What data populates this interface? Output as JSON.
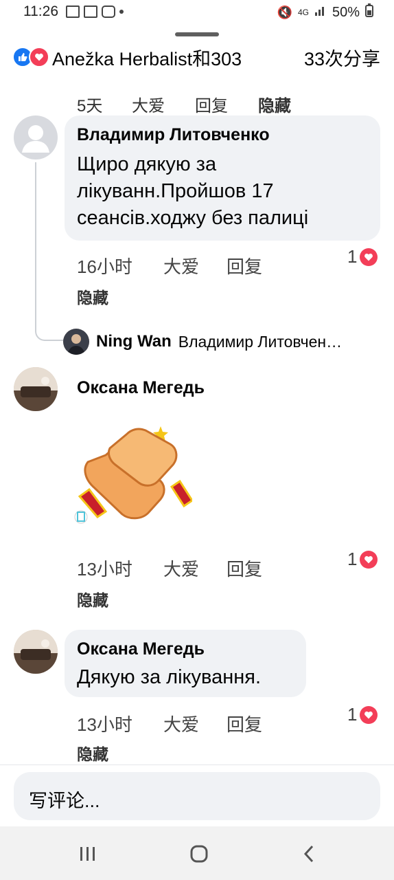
{
  "status_bar": {
    "time": "11:26",
    "battery": "50%",
    "network": "4G"
  },
  "header": {
    "reaction_names": "Anežka Herbalist和303",
    "shares": "33次分享",
    "cutoff_text": [
      "5天",
      "大爱",
      "回复",
      "隐藏"
    ]
  },
  "comments": [
    {
      "author": "Владимир Литовченко",
      "text": "Щиро дякую за лікуванн.Пройшов 17 сеансів.ходжу без палиці",
      "time": "16小时",
      "like": "大爱",
      "reply": "回复",
      "hide": "隐藏",
      "reaction_count": "1",
      "reply_preview": {
        "author": "Ning Wan",
        "text": "Владимир Литовчен…"
      }
    },
    {
      "author": "Оксана Мегедь",
      "text": "",
      "sticker": "clapping-hands-sticker",
      "time": "13小时",
      "like": "大爱",
      "reply": "回复",
      "hide": "隐藏",
      "reaction_count": "1"
    },
    {
      "author": "Оксана Мегедь",
      "text": "Дякую за лікування.",
      "time": "13小时",
      "like": "大爱",
      "reply": "回复",
      "hide": "隐藏",
      "reaction_count": "1"
    }
  ],
  "composer": {
    "placeholder": "写评论..."
  },
  "colors": {
    "accent": "#1877f2",
    "love": "#f33e58",
    "bubble": "#f0f2f5"
  }
}
